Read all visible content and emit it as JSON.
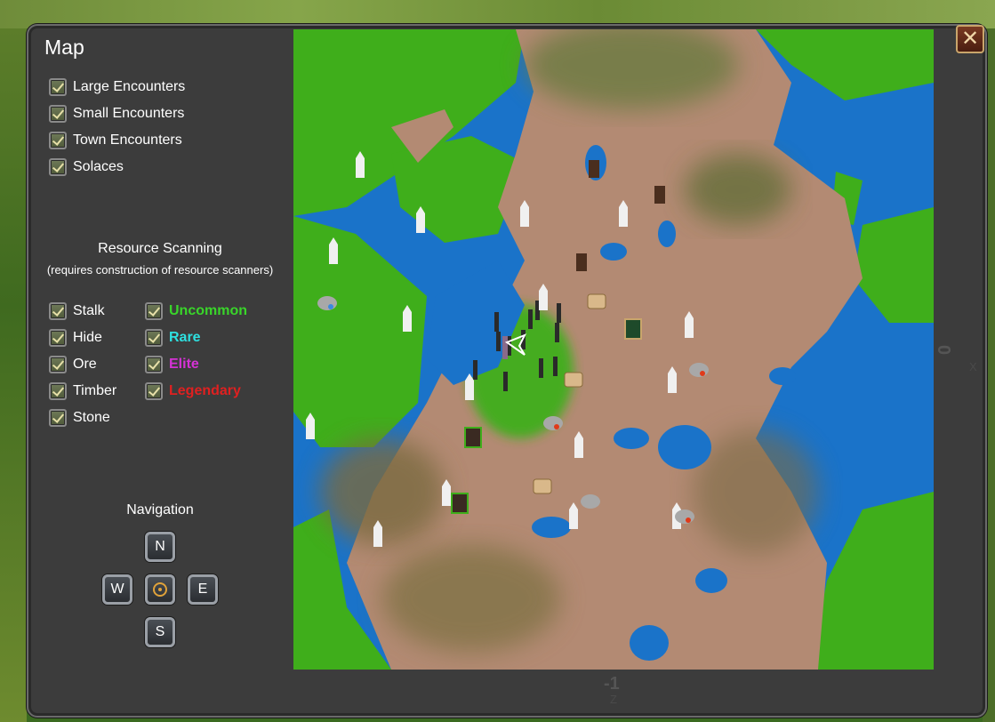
{
  "window": {
    "title": "Map",
    "close_label": "✕"
  },
  "encounters": [
    {
      "label": "Large Encounters",
      "checked": true
    },
    {
      "label": "Small Encounters",
      "checked": true
    },
    {
      "label": "Town Encounters",
      "checked": true
    },
    {
      "label": "Solaces",
      "checked": true
    }
  ],
  "resource_scanning": {
    "title": "Resource Scanning",
    "subtitle": "(requires construction of resource scanners)",
    "types": [
      {
        "label": "Stalk",
        "checked": true
      },
      {
        "label": "Hide",
        "checked": true
      },
      {
        "label": "Ore",
        "checked": true
      },
      {
        "label": "Timber",
        "checked": true
      },
      {
        "label": "Stone",
        "checked": true
      }
    ],
    "rarities": [
      {
        "label": "Uncommon",
        "checked": true,
        "color": "#39d52a"
      },
      {
        "label": "Rare",
        "checked": true,
        "color": "#2ee0e0"
      },
      {
        "label": "Elite",
        "checked": true,
        "color": "#d532d5"
      },
      {
        "label": "Legendary",
        "checked": true,
        "color": "#e02020"
      }
    ]
  },
  "navigation": {
    "title": "Navigation",
    "north": "N",
    "west": "W",
    "east": "E",
    "south": "S",
    "center_icon": "target-icon"
  },
  "axes": {
    "x_value": "0",
    "x_name": "X",
    "z_value": "-1",
    "z_name": "Z"
  },
  "colors": {
    "water": "#1a73c9",
    "land": "#b38a73",
    "grass": "#3fae1b"
  }
}
